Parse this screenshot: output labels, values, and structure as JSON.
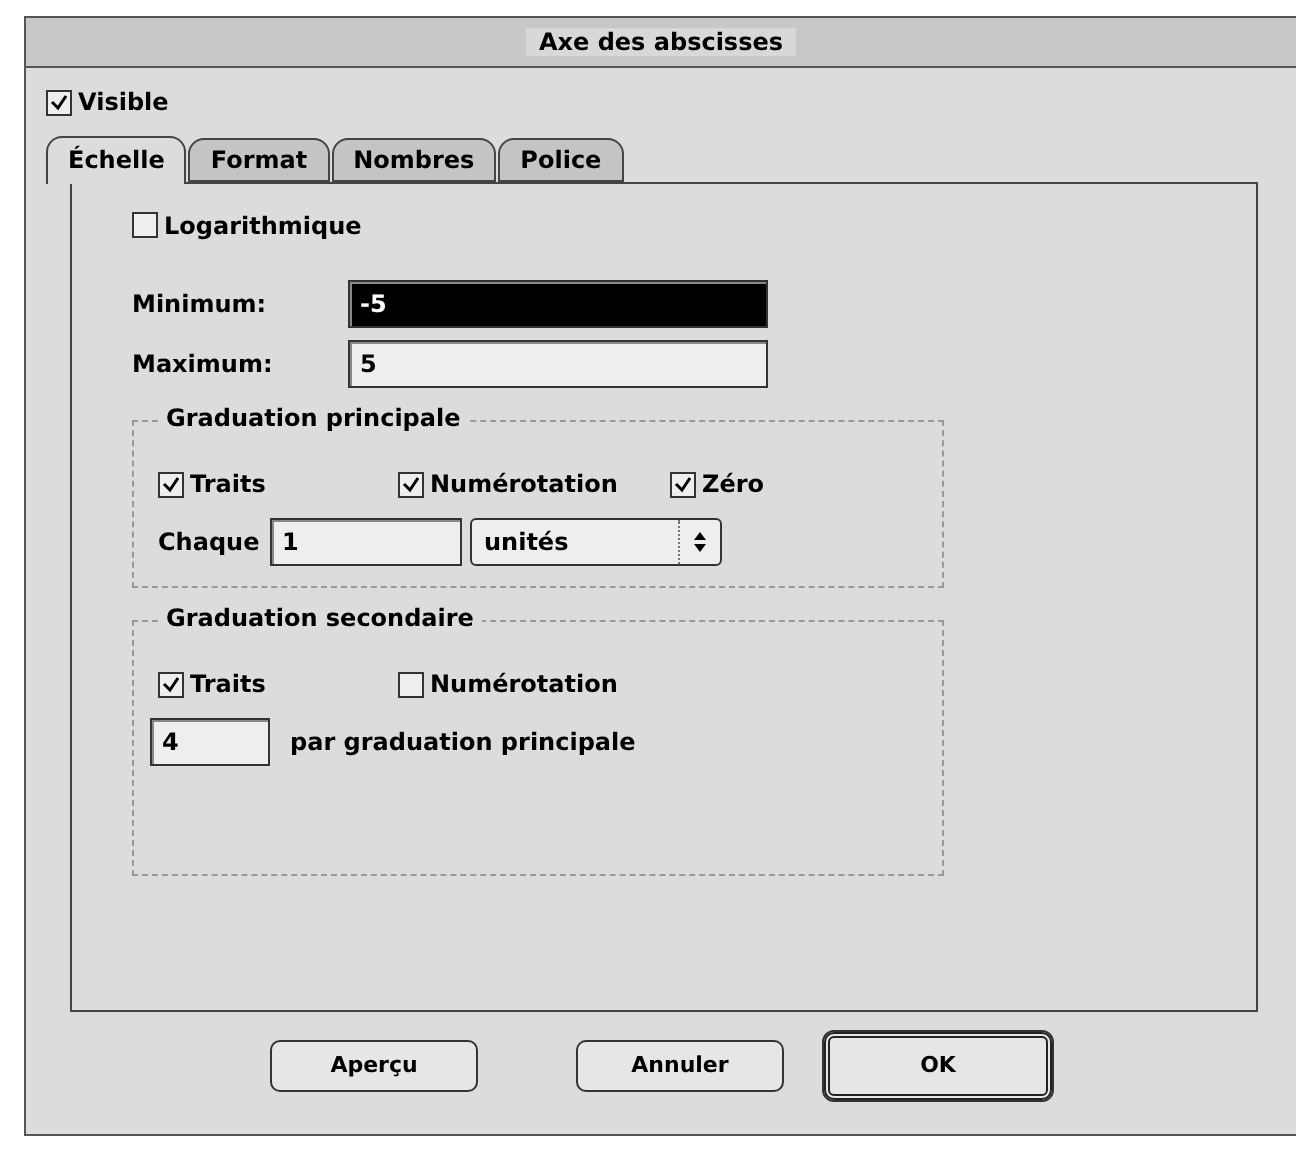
{
  "window": {
    "title": "Axe des abscisses"
  },
  "visible": {
    "label": "Visible",
    "checked": true
  },
  "tabs": [
    {
      "label": "Échelle",
      "selected": true
    },
    {
      "label": "Format",
      "selected": false
    },
    {
      "label": "Nombres",
      "selected": false
    },
    {
      "label": "Police",
      "selected": false
    }
  ],
  "logarithmic": {
    "label": "Logarithmique",
    "checked": false
  },
  "minimum": {
    "label": "Minimum:",
    "value": "-5",
    "selected": true
  },
  "maximum": {
    "label": "Maximum:",
    "value": "5",
    "selected": false
  },
  "major": {
    "title": "Graduation principale",
    "checks": [
      {
        "label": "Traits",
        "checked": true
      },
      {
        "label": "Numérotation",
        "checked": true
      },
      {
        "label": "Zéro",
        "checked": true
      }
    ],
    "every_label": "Chaque",
    "every_value": "1",
    "unit": "unités"
  },
  "minor": {
    "title": "Graduation secondaire",
    "checks": [
      {
        "label": "Traits",
        "checked": true
      },
      {
        "label": "Numérotation",
        "checked": false
      }
    ],
    "count": "4",
    "count_label": "par graduation principale"
  },
  "buttons": [
    {
      "label": "Aperçu",
      "default": false
    },
    {
      "label": "Annuler",
      "default": false
    },
    {
      "label": "OK",
      "default": true
    }
  ]
}
